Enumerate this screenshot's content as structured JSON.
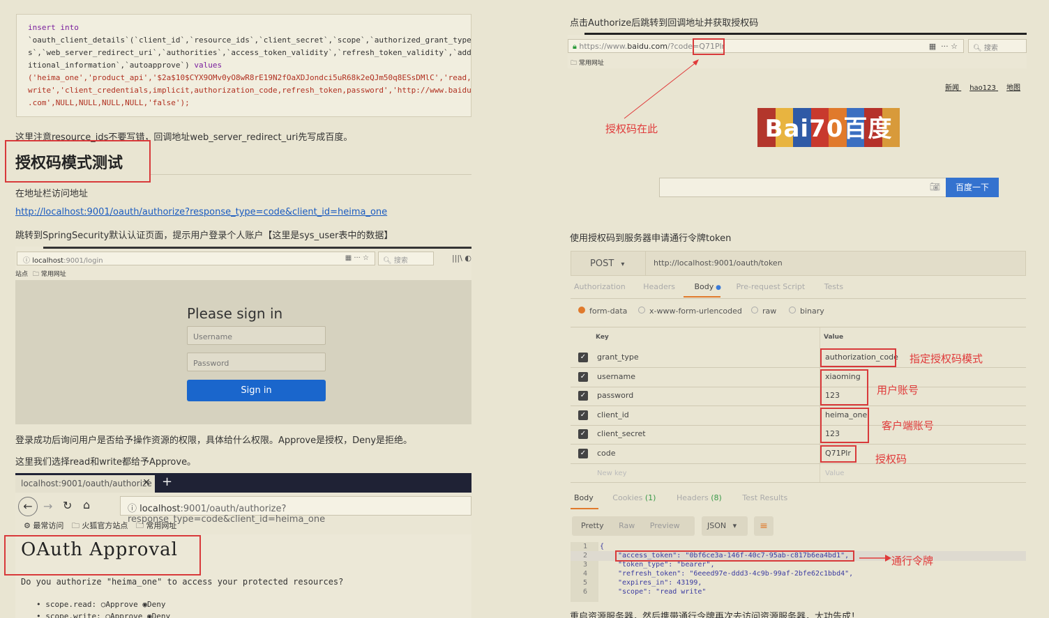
{
  "left": {
    "code": {
      "l1_kw": "insert  into",
      "l2": "`oauth_client_details`(`client_id`,`resource_ids`,`client_secret`,`scope`,`authorized_grant_type",
      "l3": "s`,`web_server_redirect_uri`,`authorities`,`access_token_validity`,`refresh_token_validity`,`add",
      "l4a": "itional_information`,`autoapprove`) ",
      "l4_kw": "values",
      "l5": "('heima_one','product_api','$2a$10$CYX9OMv0yO8wR8rE19N2fOaXDJondci5uR68k2eQJm50q8ESsDMlC','read,",
      "l6": "write','client_credentials,implicit,authorization_code,refresh_token,password','http://www.baidu",
      "l7": ".com',NULL,NULL,NULL,NULL,'false');"
    },
    "note1": "这里注意resource_ids不要写错，回调地址web_server_redirect_uri先写成百度。",
    "heading": "授权码模式测试",
    "visit": "在地址栏访问地址",
    "url": "http://localhost:9001/oauth/authorize?response_type=code&client_id=heima_one",
    "redirect_note": "跳转到SpringSecurity默认认证页面，提示用户登录个人账户【这里是sys_user表中的数据】",
    "login": {
      "url_host": "localhost",
      "url_path": ":9001/login",
      "search": "搜索",
      "bookmark_prefix": "站点",
      "bookmark": "常用网址",
      "title": "Please sign in",
      "username_ph": "Username",
      "password_ph": "Password",
      "button": "Sign in"
    },
    "after_login": "登录成功后询问用户是否给予操作资源的权限，具体给什么权限。Approve是授权，Deny是拒绝。",
    "choose": "这里我们选择read和write都给予Approve。",
    "approval": {
      "tab": "localhost:9001/oauth/authorize",
      "url_host": "localhost",
      "url_path": ":9001/oauth/authorize?response_type=code&client_id=heima_one",
      "bm1": "最常访问",
      "bm2": "火狐官方站点",
      "bm3": "常用网址",
      "title": "OAuth Approval",
      "question": "Do you authorize \"heima_one\" to access your protected resources?",
      "scope1": "scope.read:",
      "scope2": "scope.write:",
      "approve": "Approve",
      "deny": "Deny"
    }
  },
  "right": {
    "title1": "点击Authorize后跳转到回调地址并获取授权码",
    "browser": {
      "url_prefix": "https://www.",
      "url_domain": "baidu.com",
      "url_rest": "/?code=",
      "code": "Q71Plr",
      "search": "搜索",
      "bookmark": "常用网址",
      "nav1": "新闻",
      "nav2": "hao123",
      "nav3": "地图",
      "search_button": "百度一下",
      "logo_text": "Bai70百度"
    },
    "annot_code": "授权码在此",
    "title2": "使用授权码到服务器申请通行令牌token",
    "postman": {
      "method": "POST",
      "url": "http://localhost:9001/oauth/token",
      "tabs": [
        "Authorization",
        "Headers",
        "Body",
        "Pre-request Script",
        "Tests"
      ],
      "radios": [
        "form-data",
        "x-www-form-urlencoded",
        "raw",
        "binary"
      ],
      "col_key": "Key",
      "col_value": "Value",
      "rows": [
        {
          "key": "grant_type",
          "value": "authorization_code"
        },
        {
          "key": "username",
          "value": "xiaoming"
        },
        {
          "key": "password",
          "value": "123"
        },
        {
          "key": "client_id",
          "value": "heima_one"
        },
        {
          "key": "client_secret",
          "value": "123"
        },
        {
          "key": "code",
          "value": "Q71Plr"
        }
      ],
      "new_key": "New key",
      "new_value": "Value",
      "resp_tabs": {
        "body": "Body",
        "cookies": "Cookies",
        "cookies_count": "(1)",
        "headers": "Headers",
        "headers_count": "(8)",
        "tests": "Test Results"
      },
      "view_buttons": [
        "Pretty",
        "Raw",
        "Preview"
      ],
      "format": "JSON",
      "json_lines": [
        "{",
        "\"access_token\": \"0bf6ce3a-146f-40c7-95ab-c817b6ea4bd1\",",
        "\"token_type\": \"bearer\",",
        "\"refresh_token\": \"6eeed97e-ddd3-4c9b-99af-2bfe62c1bbd4\",",
        "\"expires_in\": 43199,",
        "\"scope\": \"read write\""
      ]
    },
    "annot_grant": "指定授权码模式",
    "annot_user": "用户账号",
    "annot_client": "客户端账号",
    "annot_codebox": "授权码",
    "annot_token": "通行令牌",
    "final": "重启资源服务器，然后携带通行令牌再次去访问资源服务器，大功告成！"
  }
}
